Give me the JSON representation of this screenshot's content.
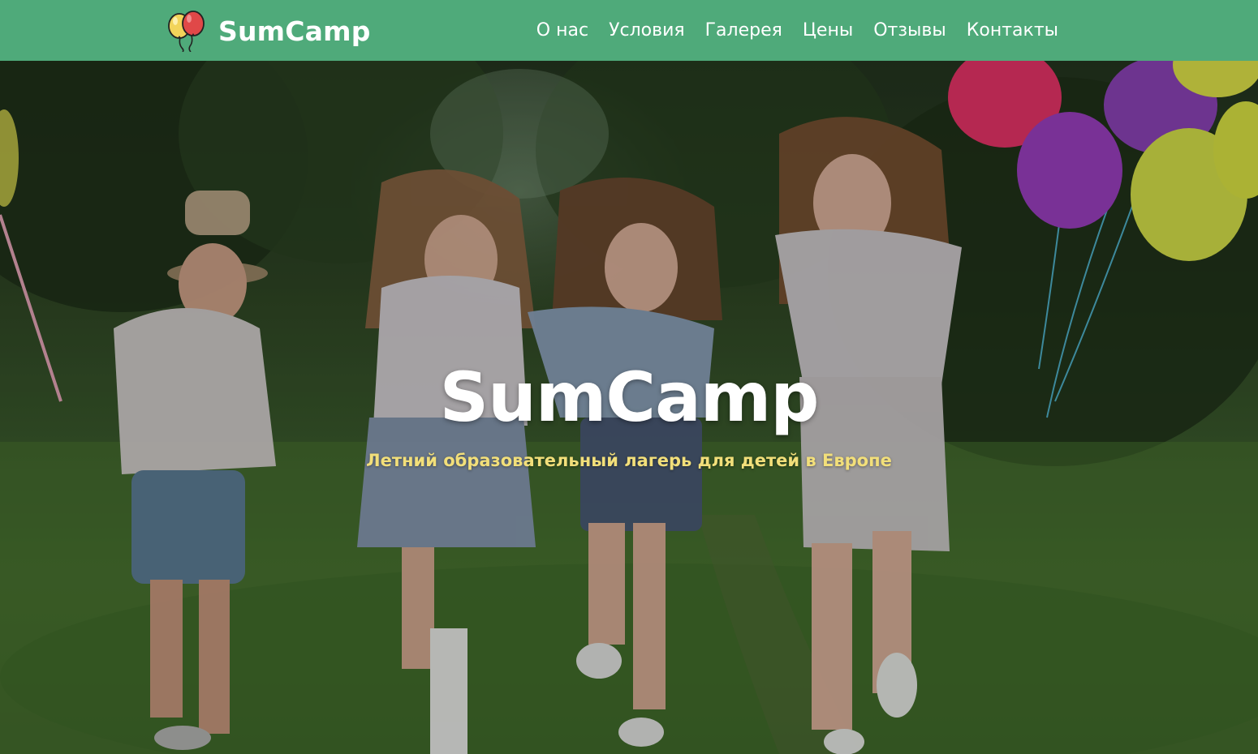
{
  "header": {
    "logo_text": "SumCamp",
    "logo_icon": "balloons-icon",
    "nav": [
      {
        "label": "О нас"
      },
      {
        "label": "Условия"
      },
      {
        "label": "Галерея"
      },
      {
        "label": "Цены"
      },
      {
        "label": "Отзывы"
      },
      {
        "label": "Контакты"
      }
    ]
  },
  "hero": {
    "title": "SumCamp",
    "subtitle": "Летний образовательный лагерь для детей в Европе",
    "image": "children-running-with-balloons-photo"
  },
  "colors": {
    "header_bg": "#4faa7a",
    "subtitle": "#f2df7a",
    "text": "#ffffff"
  }
}
